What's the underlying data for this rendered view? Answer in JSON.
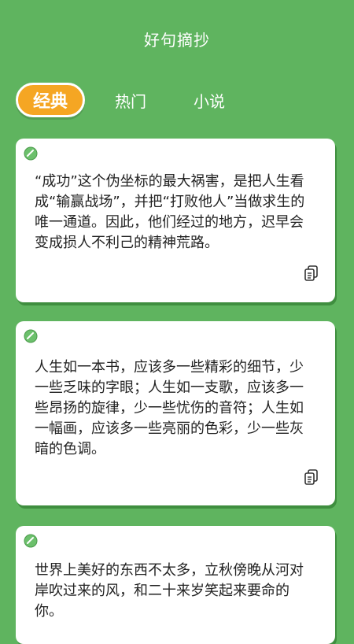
{
  "header": {
    "title": "好句摘抄"
  },
  "tabs": [
    {
      "label": "经典",
      "active": true
    },
    {
      "label": "热门",
      "active": false
    },
    {
      "label": "小说",
      "active": false
    }
  ],
  "cards": [
    {
      "text": "“成功”这个伪坐标的最大祸害，是把人生看成“输赢战场”，并把“打败他人”当做求生的唯一通道。因此，他们经过的地方，迟早会变成损人不利己的精神荒路。"
    },
    {
      "text": "人生如一本书，应该多一些精彩的细节，少一些乏味的字眼；人生如一支歌，应该多一些昂扬的旋律，少一些忧伤的音符；人生如一幅画，应该多一些亮丽的色彩，少一些灰暗的色调。"
    },
    {
      "text": "世界上美好的东西不太多，立秋傍晚从河对岸吹过来的风，和二十来岁笑起来要命的你。"
    }
  ],
  "colors": {
    "background": "#5fb45f",
    "tab_active": "#f5a623",
    "card_shadow": "#3f8e3f",
    "pin": "#6cc06c"
  },
  "icons": {
    "pin": "pin-icon",
    "copy": "copy-icon"
  }
}
